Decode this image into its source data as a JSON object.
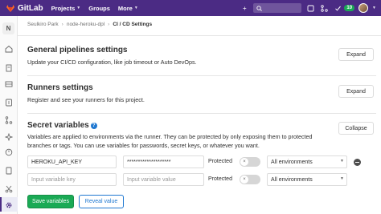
{
  "nav": {
    "brand": "GitLab",
    "links": [
      {
        "label": "Projects"
      },
      {
        "label": "Groups"
      },
      {
        "label": "More"
      }
    ],
    "badge_count": "10"
  },
  "sidebar": {
    "project_initial": "N"
  },
  "breadcrumb": {
    "items": [
      "Seulkiro Park",
      "node-heroku-dpl",
      "CI / CD Settings"
    ],
    "separator": "›"
  },
  "sections": {
    "pipelines": {
      "title": "General pipelines settings",
      "description": "Update your CI/CD configuration, like job timeout or Auto DevOps.",
      "button": "Expand"
    },
    "runners": {
      "title": "Runners settings",
      "description": "Register and see your runners for this project.",
      "button": "Expand"
    },
    "variables": {
      "title": "Secret variables",
      "description_line1": "Variables are applied to environments via the runner. They can be protected by only exposing them to protected",
      "description_line2": "branches or tags. You can use variables for passwords, secret keys, or whatever you want.",
      "button": "Collapse",
      "rows": [
        {
          "key": "HEROKU_API_KEY",
          "value": "********************",
          "protected_label": "Protected",
          "environment": "All environments"
        },
        {
          "key_placeholder": "Input variable key",
          "value_placeholder": "Input variable value",
          "protected_label": "Protected",
          "environment": "All environments"
        }
      ],
      "save_button": "Save variables",
      "reveal_button": "Reveal value"
    }
  },
  "colors": {
    "nav_bg": "#4b2b84",
    "accent_green": "#1aaa55",
    "accent_blue": "#1f78d1"
  }
}
